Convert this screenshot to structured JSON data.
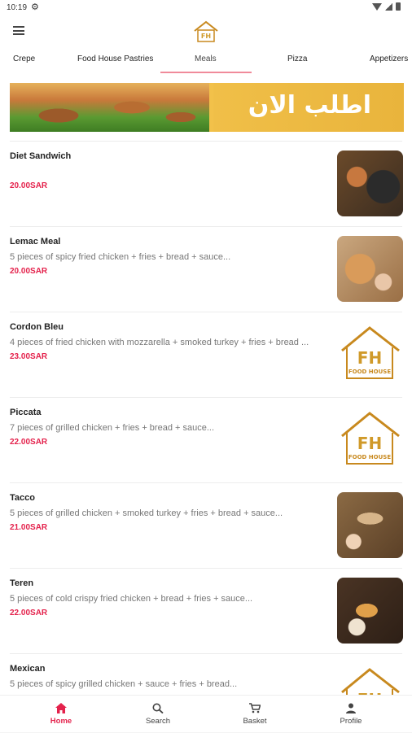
{
  "status": {
    "time": "10:19"
  },
  "tabs": [
    {
      "label": "Crepe"
    },
    {
      "label": "Food House Pastries"
    },
    {
      "label": "Meals"
    },
    {
      "label": "Pizza"
    },
    {
      "label": "Appetizers"
    }
  ],
  "active_tab": "Meals",
  "banner": {
    "text": "اطلب الان"
  },
  "items": [
    {
      "name": "Diet Sandwich",
      "desc": "",
      "price": "20.00SAR"
    },
    {
      "name": "Lemac Meal",
      "desc": "5 pieces of spicy fried chicken + fries + bread + sauce...",
      "price": "20.00SAR"
    },
    {
      "name": "Cordon Bleu",
      "desc": "4 pieces of fried chicken with mozzarella + smoked turkey + fries + bread ...",
      "price": "23.00SAR"
    },
    {
      "name": "Piccata",
      "desc": "7 pieces of grilled chicken + fries + bread + sauce...",
      "price": "22.00SAR"
    },
    {
      "name": "Tacco",
      "desc": "5 pieces of grilled chicken + smoked turkey + fries + bread + sauce...",
      "price": "21.00SAR"
    },
    {
      "name": "Teren",
      "desc": "5 pieces of cold crispy fried chicken + bread + fries + sauce...",
      "price": "22.00SAR"
    },
    {
      "name": "Mexican",
      "desc": "5 pieces of spicy grilled chicken + sauce + fries + bread...",
      "price": ""
    }
  ],
  "logo_text": {
    "letters": "FH",
    "words": "FOOD HOUSE"
  },
  "bottom_nav": [
    {
      "label": "Home",
      "icon": "home-icon"
    },
    {
      "label": "Search",
      "icon": "search-icon"
    },
    {
      "label": "Basket",
      "icon": "cart-icon"
    },
    {
      "label": "Profile",
      "icon": "person-icon"
    }
  ],
  "colors": {
    "accent": "#e4224c",
    "tab_indicator": "#f08a9a",
    "banner": "#f2c14a",
    "logo_brown": "#c8891e"
  }
}
